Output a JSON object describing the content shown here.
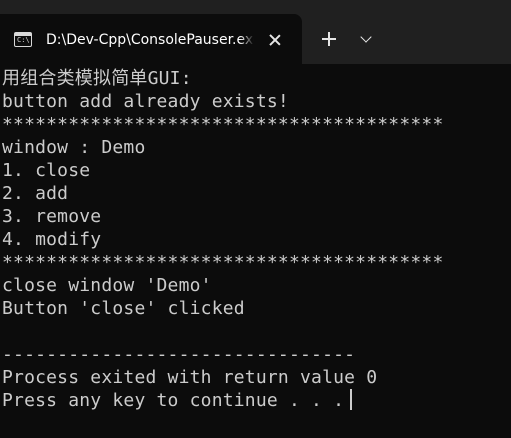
{
  "titlebar": {
    "tab_title": "D:\\Dev-Cpp\\ConsolePauser.exe",
    "tab_icon": "console-icon",
    "close_icon": "close-icon",
    "new_tab_icon": "plus-icon",
    "dropdown_icon": "chevron-down-icon"
  },
  "console": {
    "lines": [
      "用组合类模拟简单GUI:",
      "button add already exists!",
      "****************************************",
      "window : Demo",
      "1. close",
      "2. add",
      "3. remove",
      "4. modify",
      "****************************************",
      "close window 'Demo'",
      "Button 'close' clicked",
      "",
      "--------------------------------",
      "Process exited with return value 0",
      "Press any key to continue . . ."
    ]
  },
  "colors": {
    "terminal_bg": "#0c0c0c",
    "titlebar_bg": "#202020",
    "text": "#cccccc"
  }
}
